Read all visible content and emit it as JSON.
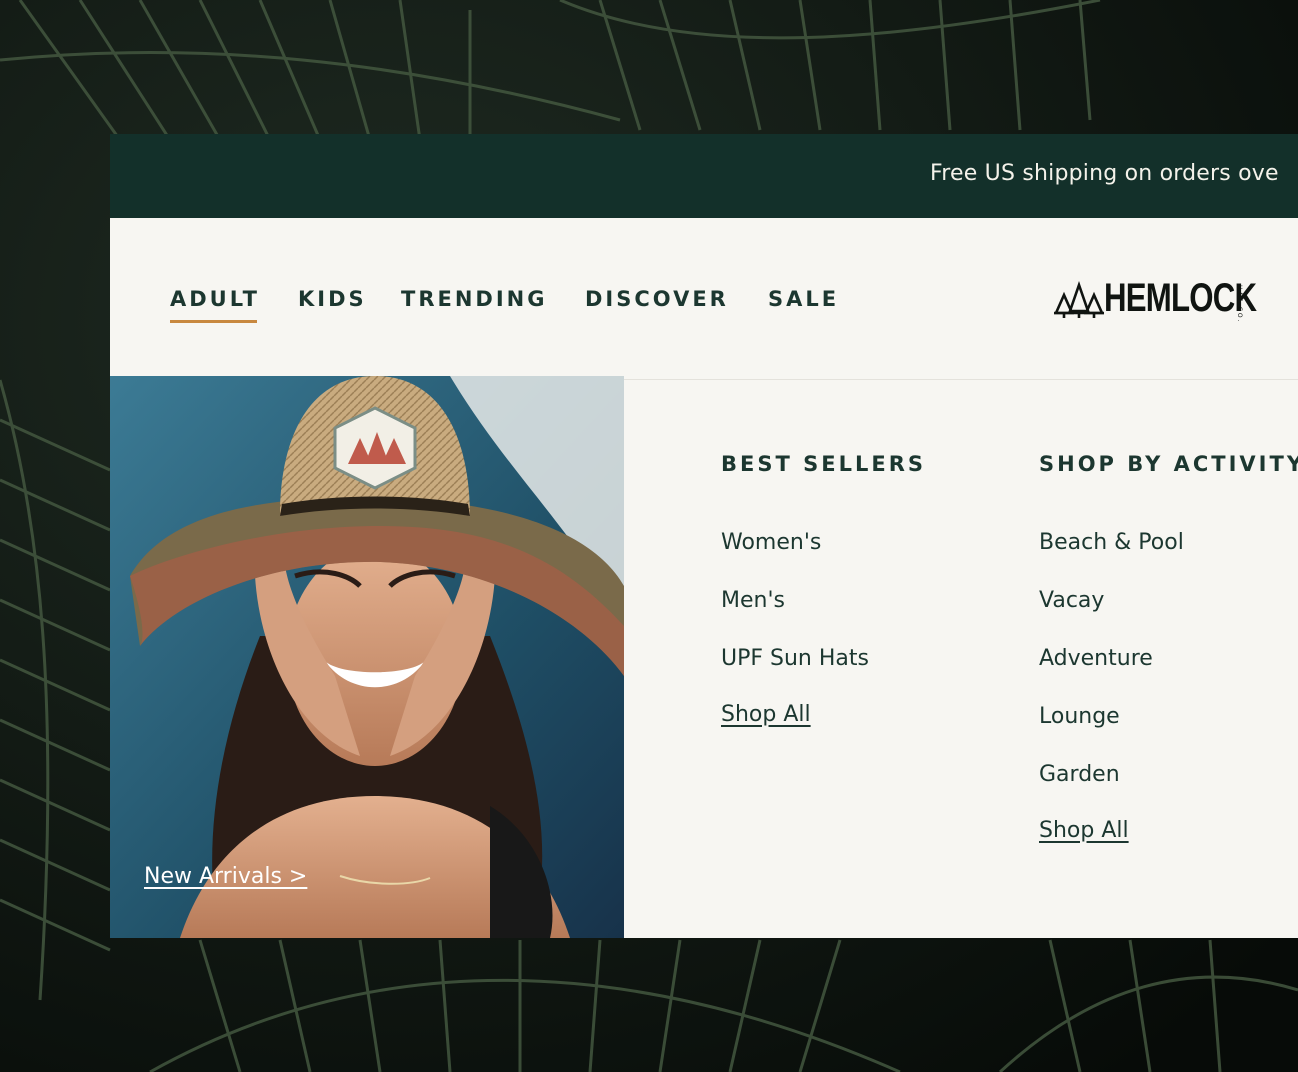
{
  "announcement": {
    "text": "Free US shipping on orders ove"
  },
  "nav": {
    "items": [
      {
        "label": "ADULT",
        "active": true
      },
      {
        "label": "KIDS",
        "active": false
      },
      {
        "label": "TRENDING",
        "active": false
      },
      {
        "label": "DISCOVER",
        "active": false
      },
      {
        "label": "SALE",
        "active": false
      }
    ],
    "active_color": "#c8883f"
  },
  "logo": {
    "name": "HEMLOCK",
    "subtitle": "HAT CO.",
    "icon": "pine-trees-icon"
  },
  "promo": {
    "link_label": "New Arrivals >"
  },
  "menu": {
    "best_sellers": {
      "title": "BEST SELLERS",
      "items": [
        "Women's",
        "Men's",
        "UPF Sun Hats",
        "Shop All"
      ]
    },
    "shop_by_activity": {
      "title": "SHOP BY ACTIVITY",
      "items": [
        "Beach & Pool",
        "Vacay",
        "Adventure",
        "Lounge",
        "Garden",
        "Shop All"
      ]
    }
  },
  "colors": {
    "brand_dark": "#13302a",
    "text_dark": "#1c3730",
    "panel_bg": "#f7f6f2"
  }
}
